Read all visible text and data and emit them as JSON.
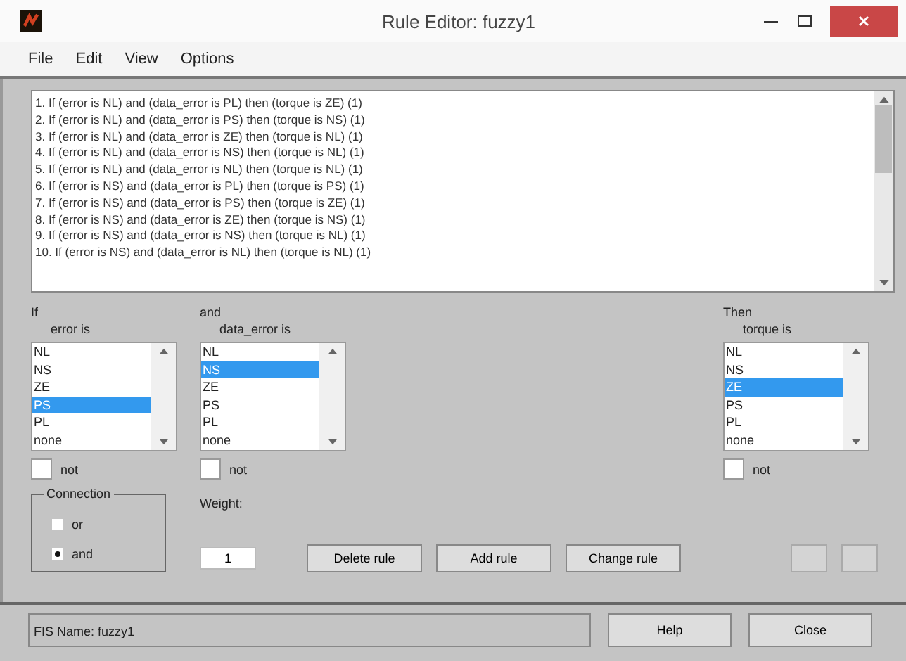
{
  "window": {
    "title": "Rule Editor: fuzzy1"
  },
  "menu": [
    "File",
    "Edit",
    "View",
    "Options"
  ],
  "rules": [
    "1. If (error is NL) and (data_error is PL) then (torque is ZE) (1)",
    "2. If (error is NL) and (data_error is PS) then (torque is NS) (1)",
    "3. If (error is NL) and (data_error is ZE) then (torque is NL) (1)",
    "4. If (error is NL) and (data_error is NS) then (torque is NL) (1)",
    "5. If (error is NL) and (data_error is NL) then (torque is NL) (1)",
    "6. If (error is NS) and (data_error is PL) then (torque is PS) (1)",
    "7. If (error is NS) and (data_error is PS) then (torque is ZE) (1)",
    "8. If (error is NS) and (data_error is ZE) then (torque is NS) (1)",
    "9. If (error is NS) and (data_error is NS) then (torque is NL) (1)",
    "10. If (error is NS) and (data_error is NL) then (torque is NL) (1)"
  ],
  "variables": [
    {
      "prefix": "If",
      "name": "error is",
      "not_label": "not",
      "not_checked": false,
      "items": [
        {
          "label": "NL",
          "selected": false
        },
        {
          "label": "NS",
          "selected": false
        },
        {
          "label": "ZE",
          "selected": false
        },
        {
          "label": "PS",
          "selected": true
        },
        {
          "label": "PL",
          "selected": false
        },
        {
          "label": "none",
          "selected": false
        }
      ]
    },
    {
      "prefix": "and",
      "name": "data_error is",
      "not_label": "not",
      "not_checked": false,
      "items": [
        {
          "label": "NL",
          "selected": false
        },
        {
          "label": "NS",
          "selected": true
        },
        {
          "label": "ZE",
          "selected": false
        },
        {
          "label": "PS",
          "selected": false
        },
        {
          "label": "PL",
          "selected": false
        },
        {
          "label": "none",
          "selected": false
        }
      ]
    },
    {
      "prefix": "Then",
      "name": "torque is",
      "not_label": "not",
      "not_checked": false,
      "items": [
        {
          "label": "NL",
          "selected": false
        },
        {
          "label": "NS",
          "selected": false
        },
        {
          "label": "ZE",
          "selected": true
        },
        {
          "label": "PS",
          "selected": false
        },
        {
          "label": "PL",
          "selected": false
        },
        {
          "label": "none",
          "selected": false
        }
      ]
    }
  ],
  "connection": {
    "title": "Connection",
    "options": [
      {
        "label": "or",
        "selected": false
      },
      {
        "label": "and",
        "selected": true
      }
    ]
  },
  "weight": {
    "label": "Weight:",
    "value": "1"
  },
  "buttons": [
    "Delete rule",
    "Add rule",
    "Change rule"
  ],
  "status": "FIS Name: fuzzy1",
  "footer_buttons": [
    "Help",
    "Close"
  ]
}
